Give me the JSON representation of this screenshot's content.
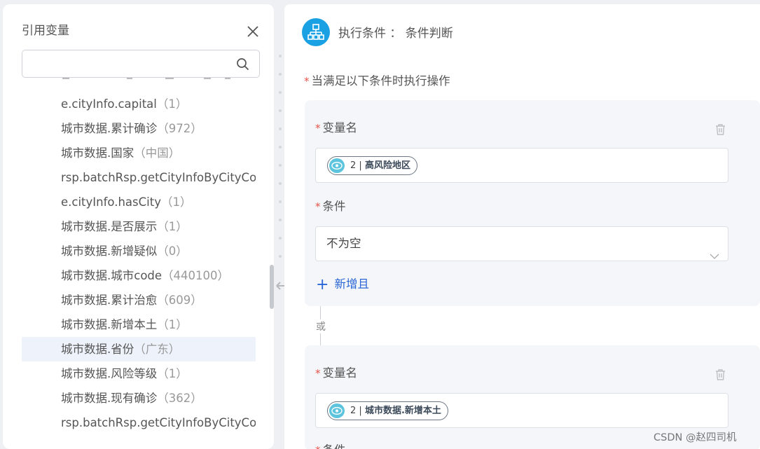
{
  "left_panel": {
    "title": "引用变量",
    "search": {
      "value": "",
      "placeholder": ""
    },
    "items": [
      {
        "label": "e.cityInfo.capital",
        "value": "（1）"
      },
      {
        "label": "城市数据.累计确诊",
        "value": "（972）"
      },
      {
        "label": "城市数据.国家",
        "value": "（中国）"
      },
      {
        "label": "rsp.batchRsp.getCityInfoByCityCod",
        "value": ""
      },
      {
        "label": "e.cityInfo.hasCity",
        "value": "（1）"
      },
      {
        "label": "城市数据.是否展示",
        "value": "（1）"
      },
      {
        "label": "城市数据.新增疑似",
        "value": "（0）"
      },
      {
        "label": "城市数据.城市code",
        "value": "（440100）"
      },
      {
        "label": "城市数据.累计治愈",
        "value": "（609）"
      },
      {
        "label": "城市数据.新增本土",
        "value": "（1）"
      },
      {
        "label": "城市数据.省份",
        "value": "（广东）"
      },
      {
        "label": "城市数据.风险等级",
        "value": "（1）"
      },
      {
        "label": "城市数据.现有确诊",
        "value": "（362）"
      },
      {
        "label": "rsp.batchRsp.getCityInfoByCityCod",
        "value": ""
      }
    ]
  },
  "right_panel": {
    "title": "执行条件 ： 条件判断",
    "condition_header": "当满足以下条件时执行操作",
    "required_mark": "*",
    "or_label": "或",
    "groups": [
      {
        "variable_label": "变量名",
        "tag_index": "2 |",
        "tag_name": "高风险地区",
        "condition_label": "条件",
        "condition_value": "不为空",
        "add_and_label": "新增且"
      },
      {
        "variable_label": "变量名",
        "tag_index": "2 |",
        "tag_name": "城市数据.新增本土",
        "condition_label": "条件"
      }
    ]
  },
  "watermark": "CSDN @赵四司机",
  "colors": {
    "accent_blue": "#1aa1e3",
    "link_blue": "#2c66d6",
    "required_red": "#e5534b",
    "tag_eye": "#5cc4dd",
    "active_row": "#edf2fb"
  },
  "icons": [
    "close-icon",
    "search-icon",
    "resize-arrows-icon",
    "org-chart-icon",
    "trash-icon",
    "eye-icon",
    "chevron-down-icon",
    "plus-icon"
  ]
}
